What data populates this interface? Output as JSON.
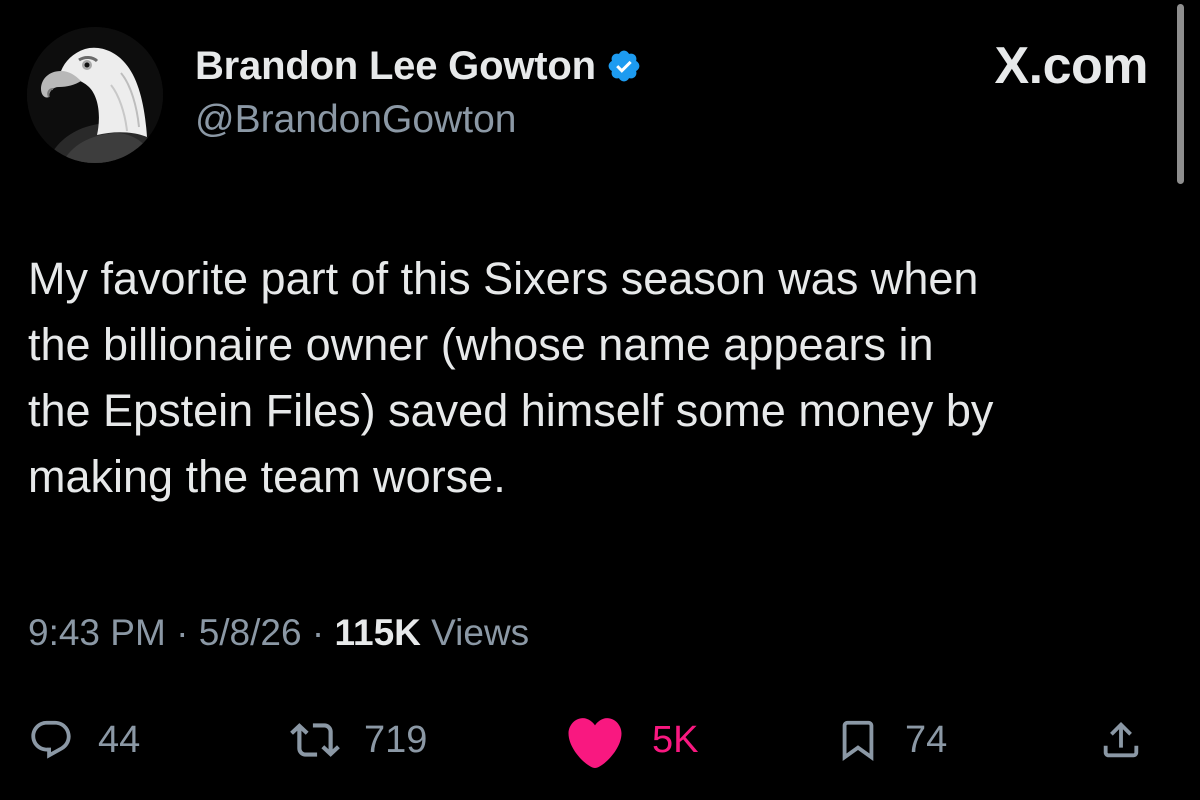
{
  "author": {
    "display_name": "Brandon Lee Gowton",
    "handle": "@BrandonGowton",
    "verified": true,
    "avatar_icon": "bald-eagle-avatar"
  },
  "brand": "X.com",
  "tweet": {
    "text": "My favorite part of this Sixers season was when\nthe billionaire owner (whose name appears in\nthe Epstein Files) saved himself some money by\nmaking the team worse."
  },
  "meta": {
    "time": "9:43 PM",
    "separator": "·",
    "date": "5/8/26",
    "views_count": "115K",
    "views_label": "Views"
  },
  "actions": {
    "replies": {
      "icon": "reply-icon",
      "count": "44"
    },
    "reposts": {
      "icon": "repost-icon",
      "count": "719"
    },
    "likes": {
      "icon": "heart-icon",
      "count": "5K",
      "liked": true
    },
    "bookmarks": {
      "icon": "bookmark-icon",
      "count": "74"
    },
    "share": {
      "icon": "share-icon"
    }
  },
  "colors": {
    "background": "#000000",
    "text_primary": "#e7e9ea",
    "text_secondary": "#8b98a5",
    "verified_blue": "#1d9bf0",
    "like_pink": "#f91880"
  }
}
